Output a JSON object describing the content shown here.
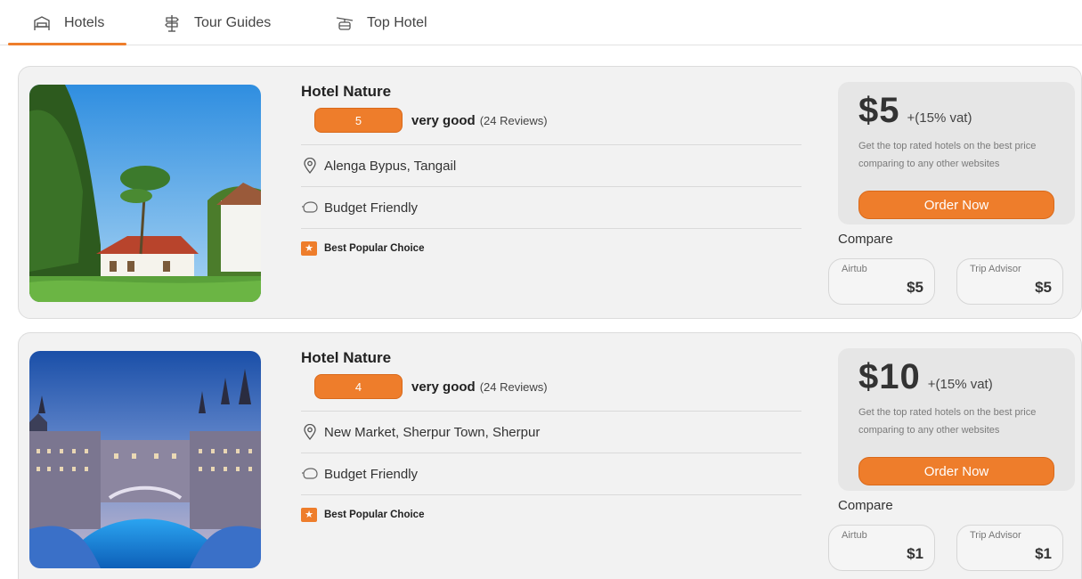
{
  "tabs": [
    {
      "label": "Hotels",
      "icon": "bed-icon",
      "active": true
    },
    {
      "label": "Tour Guides",
      "icon": "signpost-icon",
      "active": false
    },
    {
      "label": "Top Hotel",
      "icon": "cable-car-icon",
      "active": false
    }
  ],
  "accent_color": "#ee7d2b",
  "hotels": [
    {
      "name": "Hotel Nature",
      "rating": "5",
      "rating_text": "very good",
      "reviews": "(24 Reviews)",
      "location": "Alenga Bypus, Tangail",
      "feature": "Budget Friendly",
      "badge": "Best Popular Choice",
      "price": "$5",
      "vat": "+(15% vat)",
      "price_desc": "Get the top rated hotels on the best price comparing to any other websites",
      "order_label": "Order Now",
      "compare_label": "Compare",
      "compare": [
        {
          "site": "Airtub",
          "price": "$5"
        },
        {
          "site": "Trip Advisor",
          "price": "$5"
        }
      ]
    },
    {
      "name": "Hotel Nature",
      "rating": "4",
      "rating_text": "very good",
      "reviews": "(24 Reviews)",
      "location": "New Market, Sherpur Town, Sherpur",
      "feature": "Budget Friendly",
      "badge": "Best Popular Choice",
      "price": "$10",
      "vat": "+(15% vat)",
      "price_desc": "Get the top rated hotels on the best price comparing to any other websites",
      "order_label": "Order Now",
      "compare_label": "Compare",
      "compare": [
        {
          "site": "Airtub",
          "price": "$1"
        },
        {
          "site": "Trip Advisor",
          "price": "$1"
        }
      ]
    }
  ]
}
